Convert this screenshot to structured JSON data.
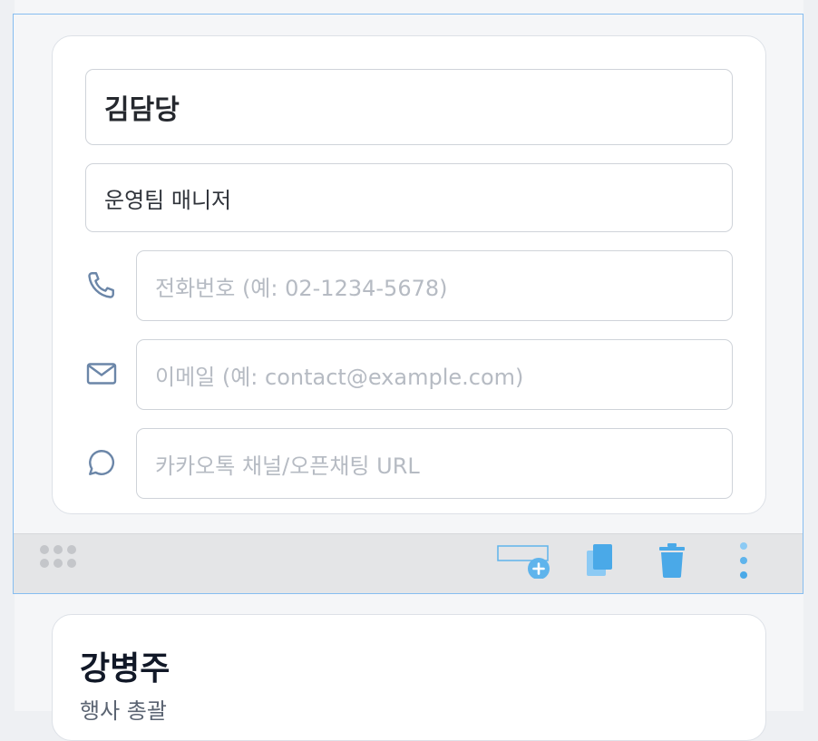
{
  "contact_card": {
    "name_value": "김담당",
    "title_value": "운영팀 매니저",
    "phone": {
      "icon": "phone-icon",
      "placeholder": "전화번호 (예: 02-1234-5678)",
      "value": ""
    },
    "email": {
      "icon": "mail-icon",
      "placeholder": "이메일 (예: contact@example.com)",
      "value": ""
    },
    "chat": {
      "icon": "chat-bubble-icon",
      "placeholder": "카카오톡 채널/오픈채팅 URL",
      "value": ""
    }
  },
  "toolbar": {
    "drag_icon": "drag-handle-icon",
    "add_icon": "add-block-icon",
    "copy_icon": "copy-icon",
    "delete_icon": "trash-icon",
    "more_icon": "more-vertical-icon",
    "accent": "#5fb4ec"
  },
  "next_card": {
    "name": "강병주",
    "title": "행사 총괄"
  },
  "colors": {
    "selection_border": "#86bdf0",
    "icon_stroke": "#6b86a8"
  }
}
